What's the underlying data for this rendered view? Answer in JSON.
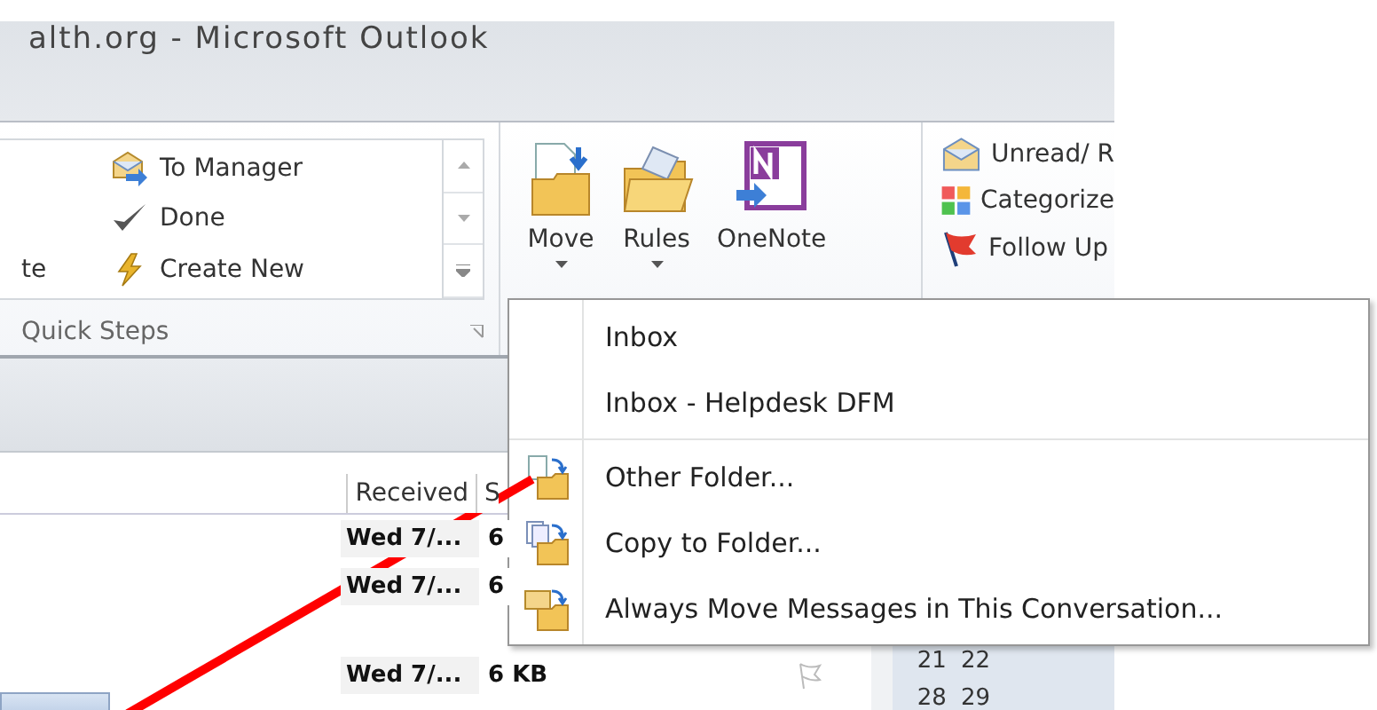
{
  "window": {
    "title": "alth.org - Microsoft Outlook"
  },
  "quick_steps": {
    "partial_item": "te",
    "items": [
      {
        "label": "To Manager",
        "kind": "forward"
      },
      {
        "label": "Done",
        "kind": "check"
      },
      {
        "label": "Create New",
        "kind": "new"
      }
    ],
    "group_label": "Quick Steps"
  },
  "move_group": {
    "buttons": [
      {
        "label": "Move",
        "kind": "move",
        "dropdown": true
      },
      {
        "label": "Rules",
        "kind": "rules",
        "dropdown": true
      },
      {
        "label": "OneNote",
        "kind": "onenote",
        "dropdown": false
      }
    ]
  },
  "tags_group": {
    "items": [
      {
        "label": "Unread/ R",
        "kind": "envelope"
      },
      {
        "label": "Categorize",
        "kind": "categories"
      },
      {
        "label": "Follow Up",
        "kind": "flag"
      }
    ]
  },
  "message_list": {
    "columns": [
      "Received",
      "S"
    ],
    "rows": [
      {
        "received": "Wed 7/...",
        "size": "6"
      },
      {
        "received": "Wed 7/...",
        "size": "6"
      },
      {
        "kind": "blank"
      },
      {
        "received": "Wed 7/...",
        "size": "6 KB",
        "flag": true
      }
    ]
  },
  "calendar": {
    "rows": [
      [
        "21",
        "22"
      ],
      [
        "28",
        "29"
      ]
    ]
  },
  "move_menu": {
    "items": [
      {
        "label": "Inbox",
        "kind": "folder"
      },
      {
        "label": "Inbox - Helpdesk DFM",
        "kind": "folder"
      },
      {
        "kind": "separator"
      },
      {
        "label": "Other Folder...",
        "kind": "other"
      },
      {
        "label": "Copy to Folder...",
        "kind": "copy"
      },
      {
        "label": "Always Move Messages in This Conversation...",
        "kind": "always"
      }
    ]
  }
}
